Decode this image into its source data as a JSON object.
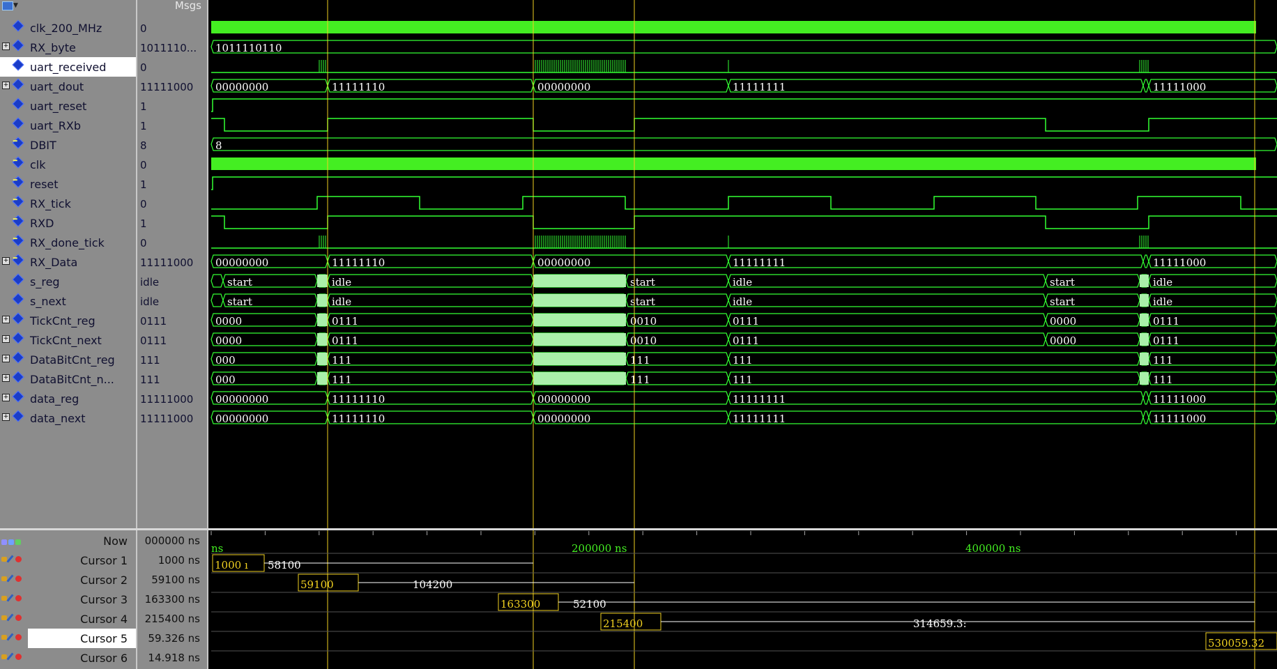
{
  "header": {
    "msgs_label": "Msgs"
  },
  "signals": [
    {
      "name": "clk_200_MHz",
      "value": "0",
      "expandable": false,
      "kind": "out"
    },
    {
      "name": "RX_byte",
      "value": "1011110...",
      "expandable": true,
      "kind": "out"
    },
    {
      "name": "uart_received",
      "value": "0",
      "expandable": false,
      "kind": "out",
      "selected": true
    },
    {
      "name": "uart_dout",
      "value": "11111000",
      "expandable": true,
      "kind": "out"
    },
    {
      "name": "uart_reset",
      "value": "1",
      "expandable": false,
      "kind": "out"
    },
    {
      "name": "uart_RXb",
      "value": "1",
      "expandable": false,
      "kind": "out"
    },
    {
      "name": "DBIT",
      "value": "8",
      "expandable": false,
      "kind": "in"
    },
    {
      "name": "clk",
      "value": "0",
      "expandable": false,
      "kind": "in"
    },
    {
      "name": "reset",
      "value": "1",
      "expandable": false,
      "kind": "in"
    },
    {
      "name": "RX_tick",
      "value": "0",
      "expandable": false,
      "kind": "in"
    },
    {
      "name": "RXD",
      "value": "1",
      "expandable": false,
      "kind": "in"
    },
    {
      "name": "RX_done_tick",
      "value": "0",
      "expandable": false,
      "kind": "in"
    },
    {
      "name": "RX_Data",
      "value": "11111000",
      "expandable": true,
      "kind": "in"
    },
    {
      "name": "s_reg",
      "value": "idle",
      "expandable": false,
      "kind": "out"
    },
    {
      "name": "s_next",
      "value": "idle",
      "expandable": false,
      "kind": "out"
    },
    {
      "name": "TickCnt_reg",
      "value": "0111",
      "expandable": true,
      "kind": "out"
    },
    {
      "name": "TickCnt_next",
      "value": "0111",
      "expandable": true,
      "kind": "out"
    },
    {
      "name": "DataBitCnt_reg",
      "value": "111",
      "expandable": true,
      "kind": "out"
    },
    {
      "name": "DataBitCnt_n...",
      "value": "111",
      "expandable": true,
      "kind": "out"
    },
    {
      "name": "data_reg",
      "value": "11111000",
      "expandable": true,
      "kind": "out"
    },
    {
      "name": "data_next",
      "value": "11111000",
      "expandable": true,
      "kind": "out"
    }
  ],
  "waves": {
    "rx_byte": "1011110110",
    "dbit": "8",
    "bus8": [
      "00000000",
      "11111110",
      "00000000",
      "11111111",
      "11111000"
    ],
    "state": [
      "start",
      "idle",
      "start",
      "idle",
      "start",
      "idle"
    ],
    "tick": [
      "0000",
      "0111",
      "0010",
      "0111",
      "0000",
      "0111"
    ],
    "bits": [
      "000",
      "111",
      "111",
      "111",
      "111"
    ]
  },
  "now": {
    "label": "Now",
    "value": "000000 ns"
  },
  "cursors": [
    {
      "label": "Cursor 1",
      "value": "1000 ns",
      "box": "1000 ı",
      "delta": "58100"
    },
    {
      "label": "Cursor 2",
      "value": "59100 ns",
      "box": "59100",
      "delta": "104200"
    },
    {
      "label": "Cursor 3",
      "value": "163300 ns",
      "box": "163300",
      "delta": "52100"
    },
    {
      "label": "Cursor 4",
      "value": "215400 ns",
      "box": "215400",
      "delta": "314659.3:"
    },
    {
      "label": "Cursor 5",
      "value": "59.326 ns",
      "box": "530059.32",
      "delta": "",
      "selected": true
    },
    {
      "label": "Cursor 6",
      "value": "14.918 ns",
      "box": "",
      "delta": ""
    }
  ],
  "timeline": {
    "ticks": [
      "ns",
      "200000 ns",
      "400000 ns"
    ]
  },
  "colors": {
    "wave": "#33ff33",
    "cursor": "#f0d020",
    "bg": "#000000",
    "pane": "#8c8c8c",
    "busfill": "#aaf0aa"
  }
}
